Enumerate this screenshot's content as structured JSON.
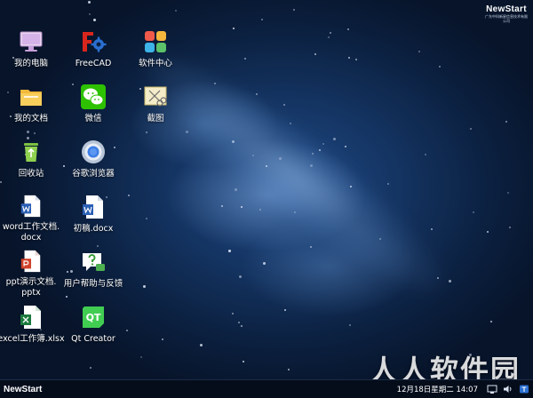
{
  "brand": {
    "logo_text": "NewStart",
    "logo_subtext": "广东中科新星信息技术有限公司"
  },
  "desktop_icons": [
    {
      "label": "我的电脑",
      "icon": "computer-icon"
    },
    {
      "label": "FreeCAD",
      "icon": "freecad-icon"
    },
    {
      "label": "软件中心",
      "icon": "software-center-icon"
    },
    {
      "label": "我的文档",
      "icon": "folder-icon"
    },
    {
      "label": "微信",
      "icon": "wechat-icon"
    },
    {
      "label": "截图",
      "icon": "screenshot-icon"
    },
    {
      "label": "回收站",
      "icon": "recycle-bin-icon"
    },
    {
      "label": "谷歌浏览器",
      "icon": "chrome-icon"
    },
    {
      "label": "word工作文档.\ndocx",
      "icon": "word-document-icon"
    },
    {
      "label": "初稿.docx",
      "icon": "word-document-icon"
    },
    {
      "label": "ppt演示文档.\npptx",
      "icon": "ppt-document-icon"
    },
    {
      "label": "用户帮助与反馈",
      "icon": "help-feedback-icon"
    },
    {
      "label": "excel工作簿.xlsx",
      "icon": "excel-document-icon"
    },
    {
      "label": "Qt Creator",
      "icon": "qt-creator-icon"
    }
  ],
  "taskbar": {
    "start_label": "NewStart",
    "clock": "12月18日星期二 14:07",
    "tray_icons": [
      "network-icon",
      "volume-icon",
      "input-method-icon"
    ]
  },
  "watermark": "人人软件园",
  "colors": {
    "wallpaper": "#143462",
    "taskbar": "#050d1b",
    "label_text": "#ffffff"
  }
}
